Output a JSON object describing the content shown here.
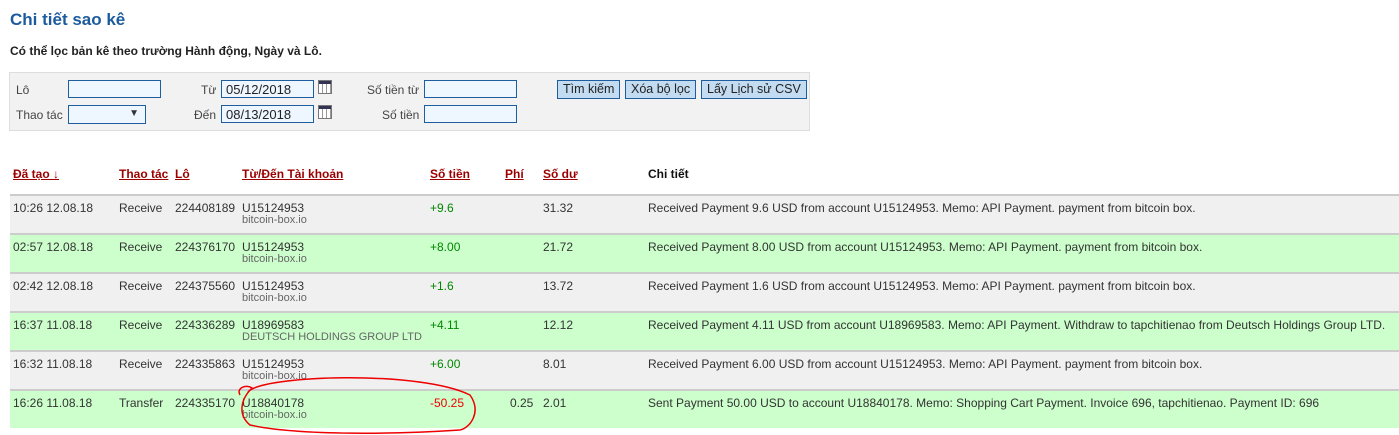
{
  "title": "Chi tiết sao kê",
  "subtitle": "Có thể lọc bản kê theo trường Hành động, Ngày và Lô.",
  "filter": {
    "batch_label": "Lô",
    "batch_value": "",
    "action_label": "Thao tác",
    "action_value": "",
    "from_label": "Từ",
    "from_value": "05/12/2018",
    "to_label": "Đến",
    "to_value": "08/13/2018",
    "amount_from_label": "Số tiền từ",
    "amount_from_value": "",
    "amount_label": "Số tiền",
    "amount_value": "",
    "search": "Tìm kiếm",
    "clear": "Xóa bộ lọc",
    "csv": "Lấy Lịch sử CSV"
  },
  "headers": {
    "created": "Đã tạo ↓",
    "action": "Thao tác",
    "batch": "Lô",
    "account": "Từ/Đến Tài khoản",
    "amount": "Số tiền",
    "fee": "Phí",
    "balance": "Số dư",
    "details": "Chi tiết"
  },
  "rows": [
    {
      "date": "10:26 12.08.18",
      "action": "Receive",
      "batch": "224408189",
      "account": "U15124953",
      "account_name": "bitcoin-box.io",
      "amount": "+9.6",
      "fee": "",
      "balance": "31.32",
      "details": "Received Payment 9.6 USD from account U15124953. Memo: API Payment. payment from bitcoin box."
    },
    {
      "date": "02:57 12.08.18",
      "action": "Receive",
      "batch": "224376170",
      "account": "U15124953",
      "account_name": "bitcoin-box.io",
      "amount": "+8.00",
      "fee": "",
      "balance": "21.72",
      "details": "Received Payment 8.00 USD from account U15124953. Memo: API Payment. payment from bitcoin box."
    },
    {
      "date": "02:42 12.08.18",
      "action": "Receive",
      "batch": "224375560",
      "account": "U15124953",
      "account_name": "bitcoin-box.io",
      "amount": "+1.6",
      "fee": "",
      "balance": "13.72",
      "details": "Received Payment 1.6 USD from account U15124953. Memo: API Payment. payment from bitcoin box."
    },
    {
      "date": "16:37 11.08.18",
      "action": "Receive",
      "batch": "224336289",
      "account": "U18969583",
      "account_name": "DEUTSCH HOLDINGS GROUP LTD",
      "amount": "+4.11",
      "fee": "",
      "balance": "12.12",
      "details": "Received Payment 4.11 USD from account U18969583. Memo: API Payment. Withdraw to tapchitienao from Deutsch Holdings Group LTD."
    },
    {
      "date": "16:32 11.08.18",
      "action": "Receive",
      "batch": "224335863",
      "account": "U15124953",
      "account_name": "bitcoin-box.io",
      "amount": "+6.00",
      "fee": "",
      "balance": "8.01",
      "details": "Received Payment 6.00 USD from account U15124953. Memo: API Payment. payment from bitcoin box."
    },
    {
      "date": "16:26 11.08.18",
      "action": "Transfer",
      "batch": "224335170",
      "account": "U18840178",
      "account_name": "bitcoin-box.io",
      "amount": "-50.25",
      "fee": "0.25",
      "balance": "2.01",
      "details": "Sent Payment 50.00 USD to account U18840178. Memo: Shopping Cart Payment. Invoice 696, tapchitienao. Payment ID: 696"
    }
  ]
}
